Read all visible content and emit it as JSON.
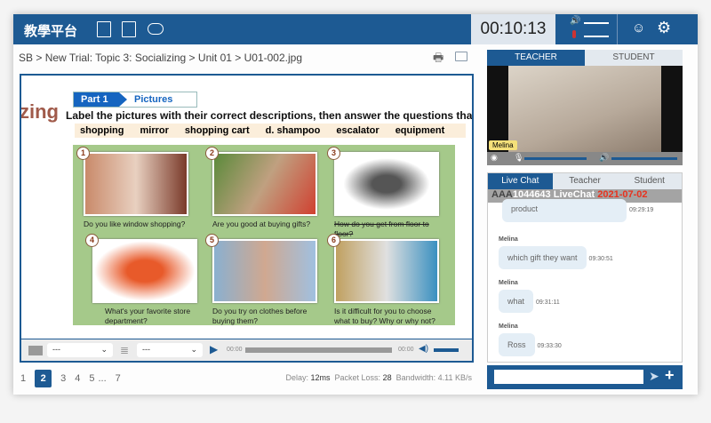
{
  "header": {
    "title": "教學平台",
    "timer": "00:10:13",
    "icons": [
      "document-list-icon",
      "dictionary-icon",
      "cloud-upload-icon",
      "volume-icon",
      "microphone-icon",
      "support-agent-icon",
      "gear-icon"
    ]
  },
  "breadcrumb": [
    "SB",
    "New Trial: Topic 3: Socializing",
    "Unit 01",
    "U01-002.jpg"
  ],
  "worksheet": {
    "part": "Part 1",
    "section": "Pictures",
    "side_text": "zing",
    "instruction": "Label the pictures with their correct descriptions, then answer the questions that follow",
    "words": [
      "shopping",
      "mirror",
      "shopping cart",
      "d. shampoo",
      "escalator",
      "equipment"
    ],
    "items": [
      {
        "n": "1",
        "q": "Do you like window shopping?"
      },
      {
        "n": "2",
        "q": "Are you good at buying gifts?"
      },
      {
        "n": "3",
        "q": "How do you get from floor to floor?"
      },
      {
        "n": "4",
        "q": "What's your favorite store department?"
      },
      {
        "n": "5",
        "q": "Do you try on clothes before buying them?"
      },
      {
        "n": "6",
        "q": "Is it difficult for you to choose what to buy? Why or why not?"
      }
    ]
  },
  "media": {
    "select1": "---",
    "select2": "---",
    "time_start": "00:00",
    "time_end": "00:00"
  },
  "pager": {
    "pages": [
      "1",
      "2",
      "3",
      "4",
      "5",
      "...",
      "7"
    ],
    "current": "2"
  },
  "stats": {
    "delay_label": "Delay:",
    "delay": "12ms",
    "loss_label": "Packet Loss:",
    "loss": "28",
    "bw_label": "Bandwidth:",
    "bw": "4.11 KB/s"
  },
  "video": {
    "tabs": [
      "TEACHER",
      "STUDENT"
    ],
    "name": "Melina"
  },
  "chat": {
    "tabs": [
      "Live Chat",
      "Teacher",
      "Student"
    ],
    "font_sizes": "AAA",
    "room": "1044643 LiveChat",
    "date": "2021-07-02",
    "messages": [
      {
        "who": "",
        "text": "product",
        "time": "09:29:19"
      },
      {
        "who": "Melina",
        "text": "which gift they want",
        "time": "09:30:51"
      },
      {
        "who": "Melina",
        "text": "what",
        "time": "09:31:11"
      },
      {
        "who": "Melina",
        "text": "Ross",
        "time": "09:33:30"
      }
    ],
    "input_value": ""
  },
  "colors": {
    "primary": "#1d5a93",
    "date": "#e8321e",
    "worksheet_bg": "#a5c98a"
  }
}
